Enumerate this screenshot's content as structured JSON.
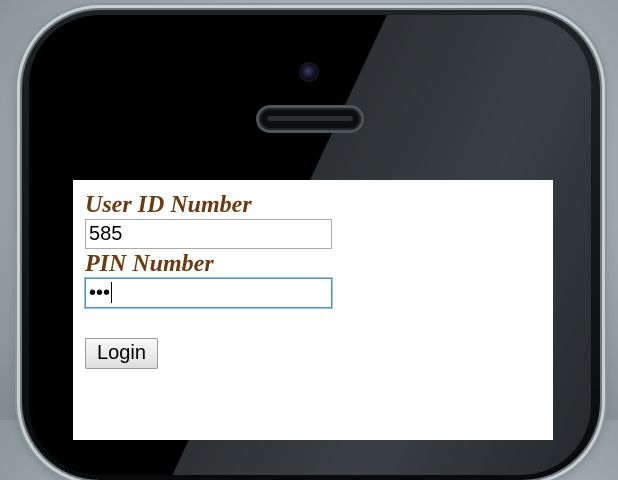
{
  "form": {
    "user_id_label": "User ID Number",
    "user_id_value": "585",
    "pin_label": "PIN Number",
    "pin_value_masked": "•••",
    "login_label": "Login"
  },
  "colors": {
    "label_color": "#6b3b10",
    "focus_border": "#4d90c8",
    "screen_background": "#ffffff"
  },
  "icons": {
    "camera": "front-camera-icon",
    "speaker": "earpiece-speaker-icon"
  }
}
